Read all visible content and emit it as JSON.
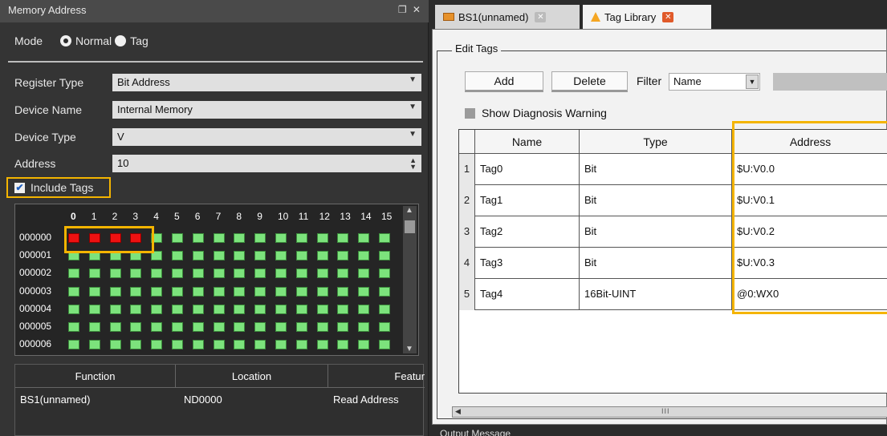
{
  "left_panel": {
    "title": "Memory Address",
    "title_controls": "❐ ✕",
    "mode_label": "Mode",
    "mode_options": [
      "Normal",
      "Tag"
    ],
    "mode_selected": "Normal",
    "fields": {
      "register_type": {
        "label": "Register Type",
        "value": "Bit Address"
      },
      "device_name": {
        "label": "Device Name",
        "value": "Internal Memory"
      },
      "device_type": {
        "label": "Device Type",
        "value": "V"
      },
      "address": {
        "label": "Address",
        "value": "10"
      }
    },
    "include_tags": {
      "label": "Include Tags",
      "checked": true
    },
    "bit_grid": {
      "column_headers": [
        "0",
        "1",
        "2",
        "3",
        "4",
        "5",
        "6",
        "7",
        "8",
        "9",
        "10",
        "11",
        "12",
        "13",
        "14",
        "15"
      ],
      "row_labels": [
        "000000",
        "000001",
        "000002",
        "000003",
        "000004",
        "000005",
        "000006"
      ],
      "tagged_bits": "000000 bits 0-3",
      "colors": {
        "normal": "#7ce37c",
        "tagged": "#ee1111"
      }
    },
    "function_table": {
      "headers": [
        "Function",
        "Location",
        "Featur"
      ],
      "rows": [
        [
          "BS1(unnamed)",
          "ND0000",
          "Read Address"
        ]
      ]
    }
  },
  "tabs": [
    {
      "label": "BS1(unnamed)",
      "active": false
    },
    {
      "label": "Tag Library",
      "active": true
    }
  ],
  "editor": {
    "group_title": "Edit Tags",
    "add_label": "Add",
    "delete_label": "Delete",
    "filter_label": "Filter",
    "filter_value": "Name",
    "show_diag_label": "Show Diagnosis Warning",
    "table_headers": [
      "Name",
      "Type",
      "Address"
    ],
    "rows": [
      {
        "num": "1",
        "name": "Tag0",
        "type": "Bit",
        "address": "$U:V0.0"
      },
      {
        "num": "2",
        "name": "Tag1",
        "type": "Bit",
        "address": "$U:V0.1"
      },
      {
        "num": "3",
        "name": "Tag2",
        "type": "Bit",
        "address": "$U:V0.2"
      },
      {
        "num": "4",
        "name": "Tag3",
        "type": "Bit",
        "address": "$U:V0.3"
      },
      {
        "num": "5",
        "name": "Tag4",
        "type": "16Bit-UINT",
        "address": "@0:WX0"
      }
    ],
    "scroll_grip": "III"
  },
  "bottom_label": "Output Message",
  "colors": {
    "highlight": "#f4b400",
    "active_tab": "#f5a623",
    "close_button": "#e05a2a"
  }
}
